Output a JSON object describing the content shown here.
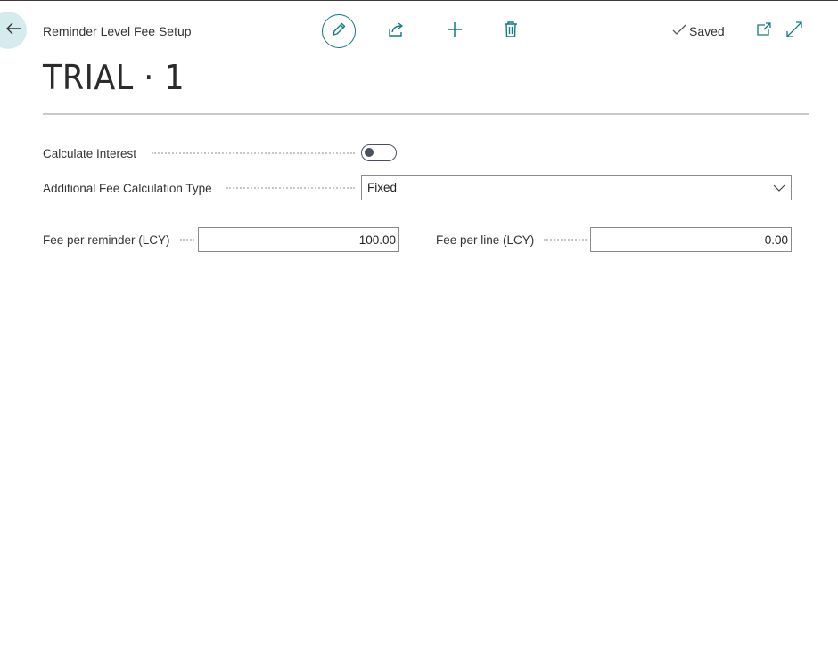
{
  "header": {
    "breadcrumb": "Reminder Level Fee Setup",
    "saved_label": "Saved",
    "title": "TRIAL · 1"
  },
  "toolbar": {
    "icons": [
      "back-arrow-icon",
      "pencil-icon",
      "share-icon",
      "plus-icon",
      "trash-icon",
      "checkmark-icon",
      "open-new-window-icon",
      "expand-icon"
    ]
  },
  "form": {
    "calculate_interest": {
      "label": "Calculate Interest",
      "value": false
    },
    "fee_calc_type": {
      "label": "Additional Fee Calculation Type",
      "value": "Fixed"
    },
    "fee_per_reminder": {
      "label": "Fee per reminder (LCY)",
      "value": "100.00"
    },
    "fee_per_line": {
      "label": "Fee per line (LCY)",
      "value": "0.00"
    }
  },
  "colors": {
    "accent": "#0f7b83",
    "back_button_bg": "#d5ecee",
    "toggle": "#4a5060"
  }
}
